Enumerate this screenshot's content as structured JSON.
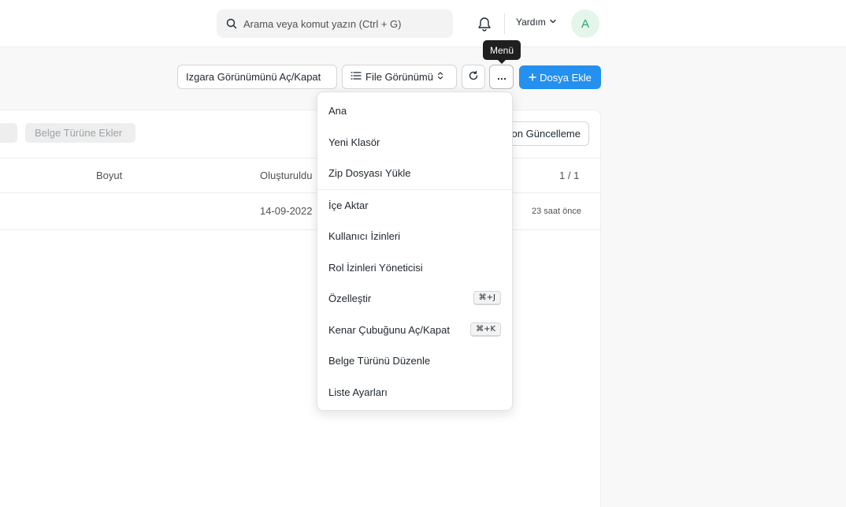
{
  "navbar": {
    "search_placeholder": "Arama veya komut yazın (Ctrl + G)",
    "help_label": "Yardım",
    "avatar_initial": "A"
  },
  "toolbar": {
    "grid_toggle_label": "Izgara Görünümünü Aç/Kapat",
    "view_select_label": "File Görünümü",
    "menu_tooltip": "Menü",
    "primary_label": "Dosya Ekle"
  },
  "list": {
    "filter_placeholder": "Belge Türüne Ekler",
    "sort_label": "Son Güncelleme",
    "columns": {
      "size": "Boyut",
      "created": "Oluşturuldu",
      "count": "1 / 1"
    },
    "row": {
      "date": "14-09-2022",
      "ago": "23 saat önce"
    }
  },
  "menu": {
    "items": [
      {
        "label": "Ana",
        "shortcut": ""
      },
      {
        "label": "Yeni Klasör",
        "shortcut": ""
      },
      {
        "label": "Zip Dosyası Yükle",
        "shortcut": ""
      },
      {
        "label": "İçe Aktar",
        "shortcut": ""
      },
      {
        "label": "Kullanıcı İzinleri",
        "shortcut": ""
      },
      {
        "label": "Rol İzinleri Yöneticisi",
        "shortcut": ""
      },
      {
        "label": "Özelleştir",
        "shortcut": "⌘+J"
      },
      {
        "label": "Kenar Çubuğunu Aç/Kapat",
        "shortcut": "⌘+K"
      },
      {
        "label": "Belge Türünü Düzenle",
        "shortcut": ""
      },
      {
        "label": "Liste Ayarları",
        "shortcut": ""
      }
    ]
  },
  "colors": {
    "primary": "#2490ef",
    "avatar_bg": "#e4f5e9",
    "avatar_fg": "#30a66d",
    "tooltip_bg": "#1f1f1f"
  },
  "icons": [
    "search-icon",
    "bell-icon",
    "chevron-down-icon",
    "list-icon",
    "sort-icon",
    "refresh-icon",
    "more-icon",
    "plus-icon"
  ]
}
